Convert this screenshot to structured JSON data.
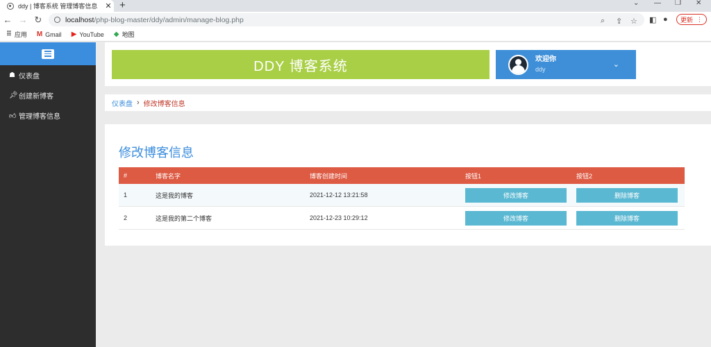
{
  "browser": {
    "tab_title": "ddy | 博客系统 管理博客信息",
    "tab_close": "✕",
    "new_tab": "+",
    "url_host": "localhost",
    "url_path": "/php-blog-master/ddy/admin/manage-blog.php",
    "update_label": "更新",
    "bookmarks": [
      {
        "label": "应用",
        "icon": "apps-grid-icon"
      },
      {
        "label": "Gmail",
        "icon": "gmail-icon"
      },
      {
        "label": "YouTube",
        "icon": "youtube-icon"
      },
      {
        "label": "地图",
        "icon": "maps-icon"
      }
    ]
  },
  "sidebar": {
    "toggle_icon": "menu-toggle-icon",
    "items": [
      {
        "label": "仪表盘",
        "icon": "dashboard-icon"
      },
      {
        "label": "创建新博客",
        "icon": "pin-icon"
      },
      {
        "label": "管理博客信息",
        "icon": "thumbs-up-icon"
      }
    ]
  },
  "header": {
    "brand": "DDY 博客系统",
    "welcome": "欢迎你",
    "username": "ddy"
  },
  "breadcrumb": {
    "home": "仪表盘",
    "current": "修改博客信息"
  },
  "content": {
    "title": "修改博客信息",
    "columns": [
      "#",
      "博客名字",
      "博客创建时间",
      "按钮1",
      "按钮2"
    ],
    "rows": [
      {
        "no": "1",
        "name": "这是我的博客",
        "created": "2021-12-12 13:21:58",
        "btn1": "修改博客",
        "btn2": "删除博客"
      },
      {
        "no": "2",
        "name": "这是我的第二个博客",
        "created": "2021-12-23 10:29:12",
        "btn1": "修改博客",
        "btn2": "删除博客"
      }
    ]
  },
  "colors": {
    "brand_bg": "#a9cf46",
    "user_bg": "#3e8fd8",
    "table_head": "#dd5a43",
    "button": "#5bb8d2",
    "sidebar": "#2d2d2d"
  }
}
